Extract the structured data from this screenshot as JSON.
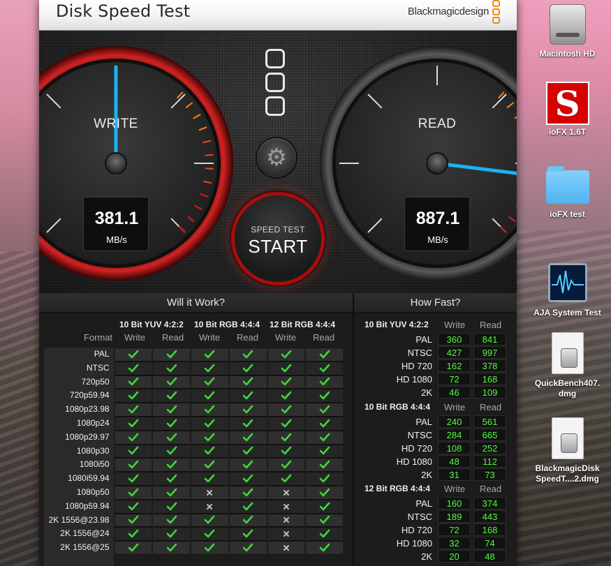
{
  "window": {
    "title": "Disk Speed Test",
    "brand": "Blackmagicdesign"
  },
  "gauges": {
    "write": {
      "label": "WRITE",
      "value": "381.1",
      "unit": "MB/s",
      "needle_fraction": 0.5
    },
    "read": {
      "label": "READ",
      "value": "887.1",
      "unit": "MB/s",
      "needle_fraction": 0.86
    }
  },
  "controls": {
    "settings_icon": "gear-icon",
    "start_small": "SPEED TEST",
    "start_big": "START"
  },
  "will_it_work": {
    "title": "Will it Work?",
    "format_label": "Format",
    "groups": [
      {
        "name": "10 Bit YUV 4:2:2",
        "write": "Write",
        "read": "Read"
      },
      {
        "name": "10 Bit RGB 4:4:4",
        "write": "Write",
        "read": "Read"
      },
      {
        "name": "12 Bit RGB 4:4:4",
        "write": "Write",
        "read": "Read"
      }
    ],
    "rows": [
      {
        "format": "PAL",
        "cells": [
          true,
          true,
          true,
          true,
          true,
          true
        ]
      },
      {
        "format": "NTSC",
        "cells": [
          true,
          true,
          true,
          true,
          true,
          true
        ]
      },
      {
        "format": "720p50",
        "cells": [
          true,
          true,
          true,
          true,
          true,
          true
        ]
      },
      {
        "format": "720p59.94",
        "cells": [
          true,
          true,
          true,
          true,
          true,
          true
        ]
      },
      {
        "format": "1080p23.98",
        "cells": [
          true,
          true,
          true,
          true,
          true,
          true
        ]
      },
      {
        "format": "1080p24",
        "cells": [
          true,
          true,
          true,
          true,
          true,
          true
        ]
      },
      {
        "format": "1080p29.97",
        "cells": [
          true,
          true,
          true,
          true,
          true,
          true
        ]
      },
      {
        "format": "1080p30",
        "cells": [
          true,
          true,
          true,
          true,
          true,
          true
        ]
      },
      {
        "format": "1080i50",
        "cells": [
          true,
          true,
          true,
          true,
          true,
          true
        ]
      },
      {
        "format": "1080i59.94",
        "cells": [
          true,
          true,
          true,
          true,
          true,
          true
        ]
      },
      {
        "format": "1080p50",
        "cells": [
          true,
          true,
          false,
          true,
          false,
          true
        ]
      },
      {
        "format": "1080p59.94",
        "cells": [
          true,
          true,
          false,
          true,
          false,
          true
        ]
      },
      {
        "format": "2K 1556@23.98",
        "cells": [
          true,
          true,
          true,
          true,
          false,
          true
        ]
      },
      {
        "format": "2K 1556@24",
        "cells": [
          true,
          true,
          true,
          true,
          false,
          true
        ]
      },
      {
        "format": "2K 1556@25",
        "cells": [
          true,
          true,
          true,
          true,
          false,
          true
        ]
      }
    ]
  },
  "how_fast": {
    "title": "How Fast?",
    "groups": [
      {
        "name": "10 Bit YUV 4:2:2",
        "write": "Write",
        "read": "Read",
        "rows": [
          {
            "format": "PAL",
            "write": "360",
            "read": "841"
          },
          {
            "format": "NTSC",
            "write": "427",
            "read": "997"
          },
          {
            "format": "HD 720",
            "write": "162",
            "read": "378"
          },
          {
            "format": "HD 1080",
            "write": "72",
            "read": "168"
          },
          {
            "format": "2K",
            "write": "46",
            "read": "109"
          }
        ]
      },
      {
        "name": "10 Bit RGB 4:4:4",
        "write": "Write",
        "read": "Read",
        "rows": [
          {
            "format": "PAL",
            "write": "240",
            "read": "561"
          },
          {
            "format": "NTSC",
            "write": "284",
            "read": "665"
          },
          {
            "format": "HD 720",
            "write": "108",
            "read": "252"
          },
          {
            "format": "HD 1080",
            "write": "48",
            "read": "112"
          },
          {
            "format": "2K",
            "write": "31",
            "read": "73"
          }
        ]
      },
      {
        "name": "12 Bit RGB 4:4:4",
        "write": "Write",
        "read": "Read",
        "rows": [
          {
            "format": "PAL",
            "write": "160",
            "read": "374"
          },
          {
            "format": "NTSC",
            "write": "189",
            "read": "443"
          },
          {
            "format": "HD 720",
            "write": "72",
            "read": "168"
          },
          {
            "format": "HD 1080",
            "write": "32",
            "read": "74"
          },
          {
            "format": "2K",
            "write": "20",
            "read": "48"
          }
        ]
      }
    ]
  },
  "desktop": [
    {
      "label": "Macintosh HD",
      "icon": "hard-drive-icon"
    },
    {
      "label": "ioFX 1.6T",
      "icon": "iofx-app-icon",
      "glyph": "S"
    },
    {
      "label": "ioFX test",
      "icon": "folder-icon"
    },
    {
      "label": "AJA System Test",
      "icon": "aja-system-test-icon"
    },
    {
      "label": "QuickBench407.\ndmg",
      "icon": "dmg-file-icon"
    },
    {
      "label": "BlackmagicDisk\nSpeedT....2.dmg",
      "icon": "dmg-file-icon"
    }
  ],
  "colors": {
    "needle": "#1ab3f0",
    "value_green": "#4dff3a",
    "write_ring": "#c01818",
    "start_ring": "#a30f0f",
    "brand_orange": "#f08a16"
  }
}
